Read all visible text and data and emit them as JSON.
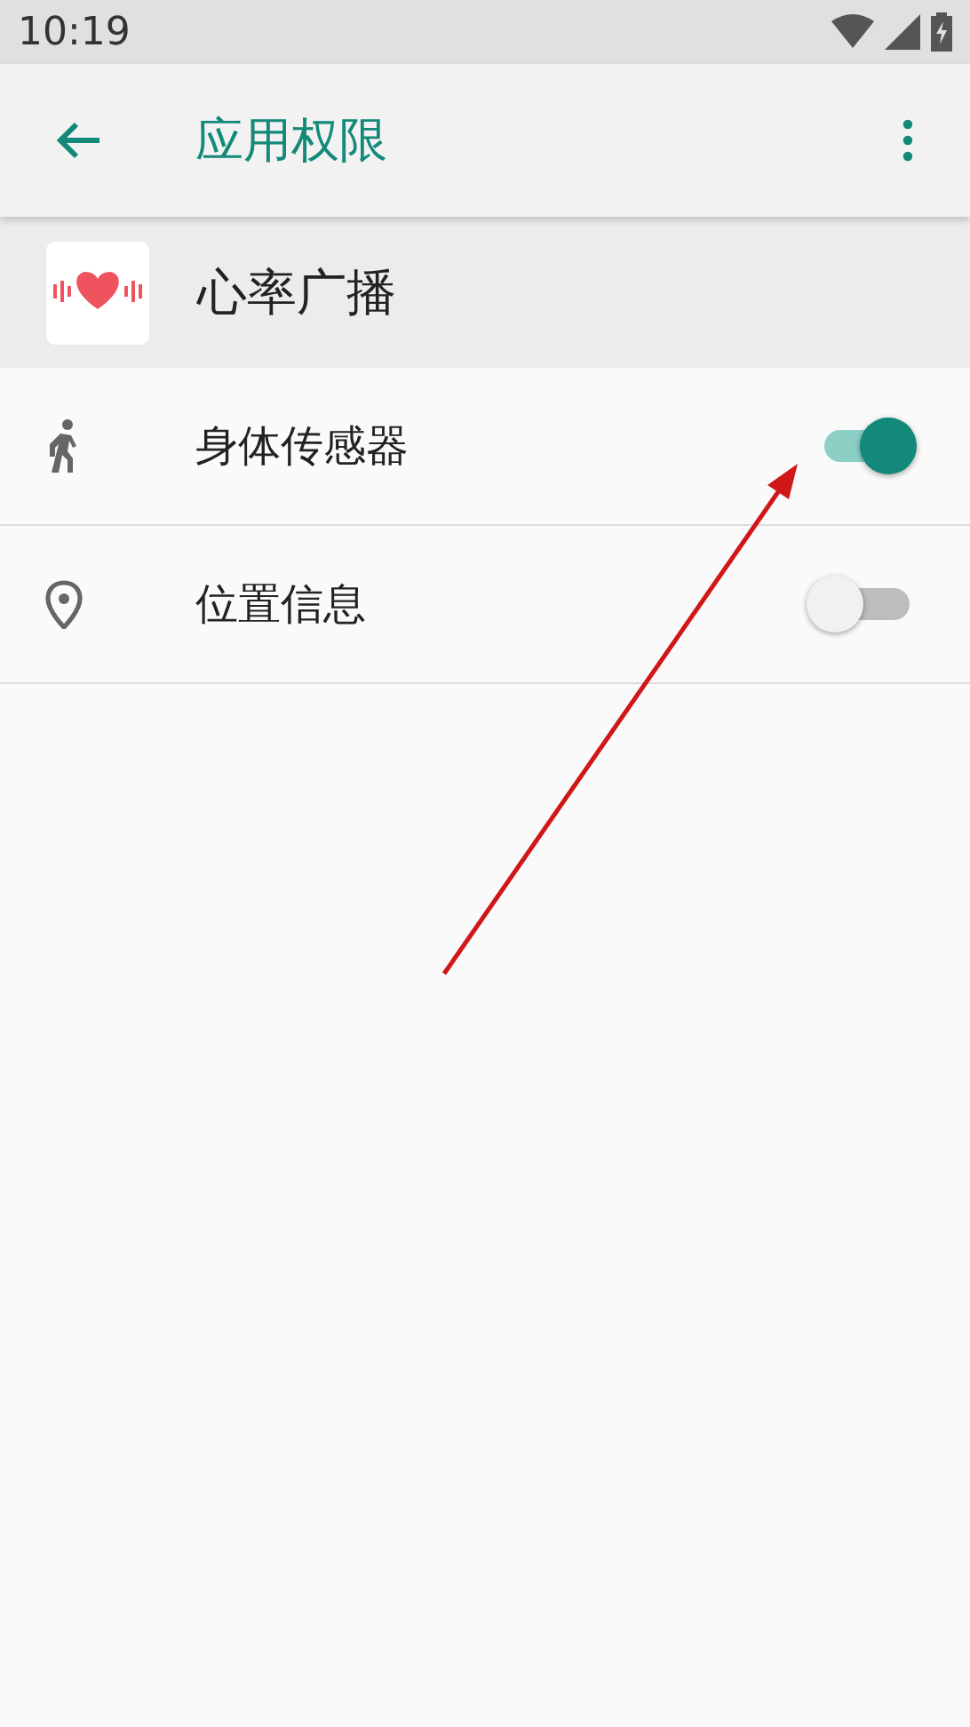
{
  "status_bar": {
    "time": "10:19"
  },
  "toolbar": {
    "title": "应用权限"
  },
  "app": {
    "name": "心率广播"
  },
  "permissions": [
    {
      "label": "身体传感器",
      "on": true
    },
    {
      "label": "位置信息",
      "on": false
    }
  ]
}
